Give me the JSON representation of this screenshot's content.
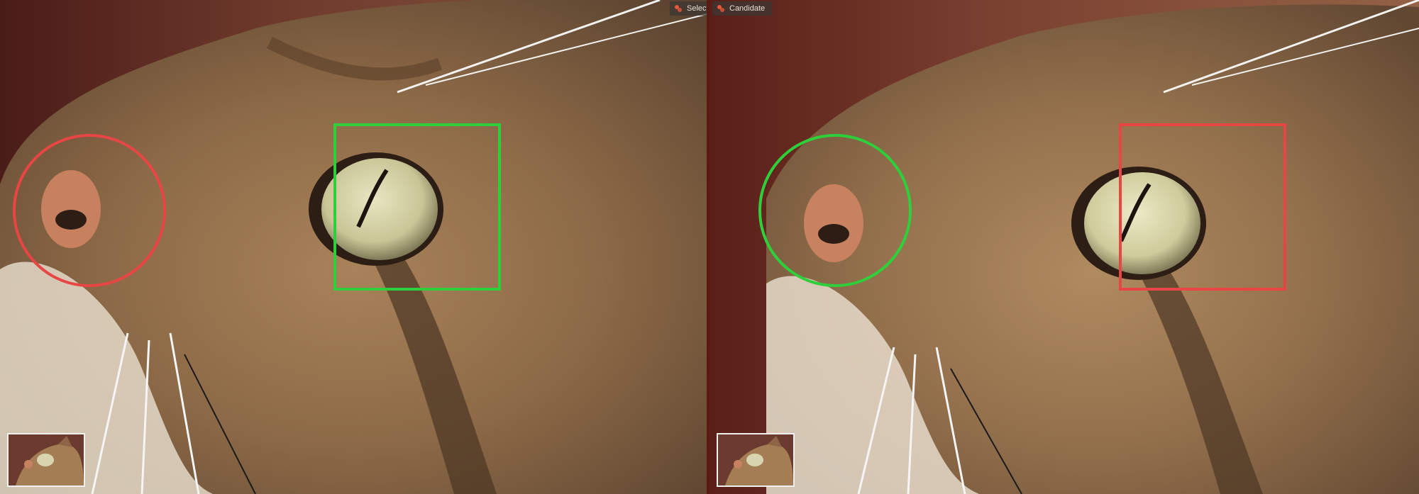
{
  "left_pane": {
    "badge_label": "Select"
  },
  "right_pane": {
    "badge_label": "Candidate"
  },
  "colors": {
    "marker_red": "#e84545",
    "marker_green": "#2fcf3c",
    "badge_icon": "#e8563a",
    "background": "#3a1410"
  },
  "icons": {
    "badge": "sparkle-icon"
  }
}
